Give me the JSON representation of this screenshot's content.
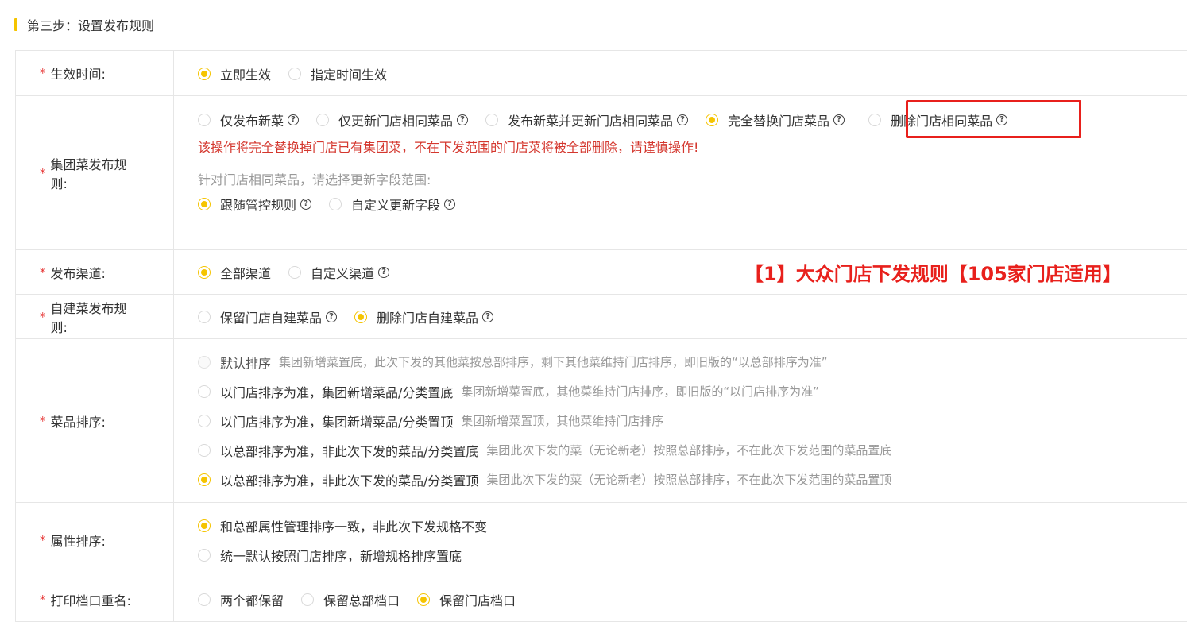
{
  "section": {
    "title": "第三步：设置发布规则"
  },
  "rows": {
    "effective_time": {
      "label": "生效时间:",
      "options": [
        "立即生效",
        "指定时间生效"
      ]
    },
    "group_dish_rule": {
      "label": "集团菜发布规则:",
      "options": [
        "仅发布新菜",
        "仅更新门店相同菜品",
        "发布新菜并更新门店相同菜品",
        "完全替换门店菜品",
        "删除门店相同菜品"
      ],
      "warning": "该操作将完全替换掉门店已有集团菜，不在下发范围的门店菜将被全部删除，请谨慎操作!",
      "field_hint": "针对门店相同菜品，请选择更新字段范围:",
      "field_options": [
        "跟随管控规则",
        "自定义更新字段"
      ]
    },
    "channel": {
      "label": "发布渠道:",
      "options": [
        "全部渠道",
        "自定义渠道"
      ],
      "banner": "【1】大众门店下发规则【105家门店适用】"
    },
    "self_dish_rule": {
      "label": "自建菜发布规则:",
      "options": [
        "保留门店自建菜品",
        "删除门店自建菜品"
      ]
    },
    "dish_sort": {
      "label": "菜品排序:",
      "options": [
        {
          "title": "默认排序",
          "desc": "集团新增菜置底，此次下发的其他菜按总部排序，剩下其他菜维持门店排序，即旧版的“以总部排序为准”"
        },
        {
          "title": "以门店排序为准，集团新增菜品/分类置底",
          "desc": "集团新增菜置底，其他菜维持门店排序，即旧版的“以门店排序为准”"
        },
        {
          "title": "以门店排序为准，集团新增菜品/分类置顶",
          "desc": "集团新增菜置顶，其他菜维持门店排序"
        },
        {
          "title": "以总部排序为准，非此次下发的菜品/分类置底",
          "desc": "集团此次下发的菜（无论新老）按照总部排序，不在此次下发范围的菜品置底"
        },
        {
          "title": "以总部排序为准，非此次下发的菜品/分类置顶",
          "desc": "集团此次下发的菜（无论新老）按照总部排序，不在此次下发范围的菜品置顶"
        }
      ]
    },
    "attr_sort": {
      "label": "属性排序:",
      "options": [
        "和总部属性管理排序一致，非此次下发规格不变",
        "统一默认按照门店排序，新增规格排序置底"
      ]
    },
    "print_dup": {
      "label": "打印档口重名:",
      "options": [
        "两个都保留",
        "保留总部档口",
        "保留门店档口"
      ]
    }
  },
  "help_glyph": "?",
  "required_mark": "*",
  "colors": {
    "accent": "#f5c400",
    "warning": "#d4372e",
    "highlight": "#e8201c"
  }
}
